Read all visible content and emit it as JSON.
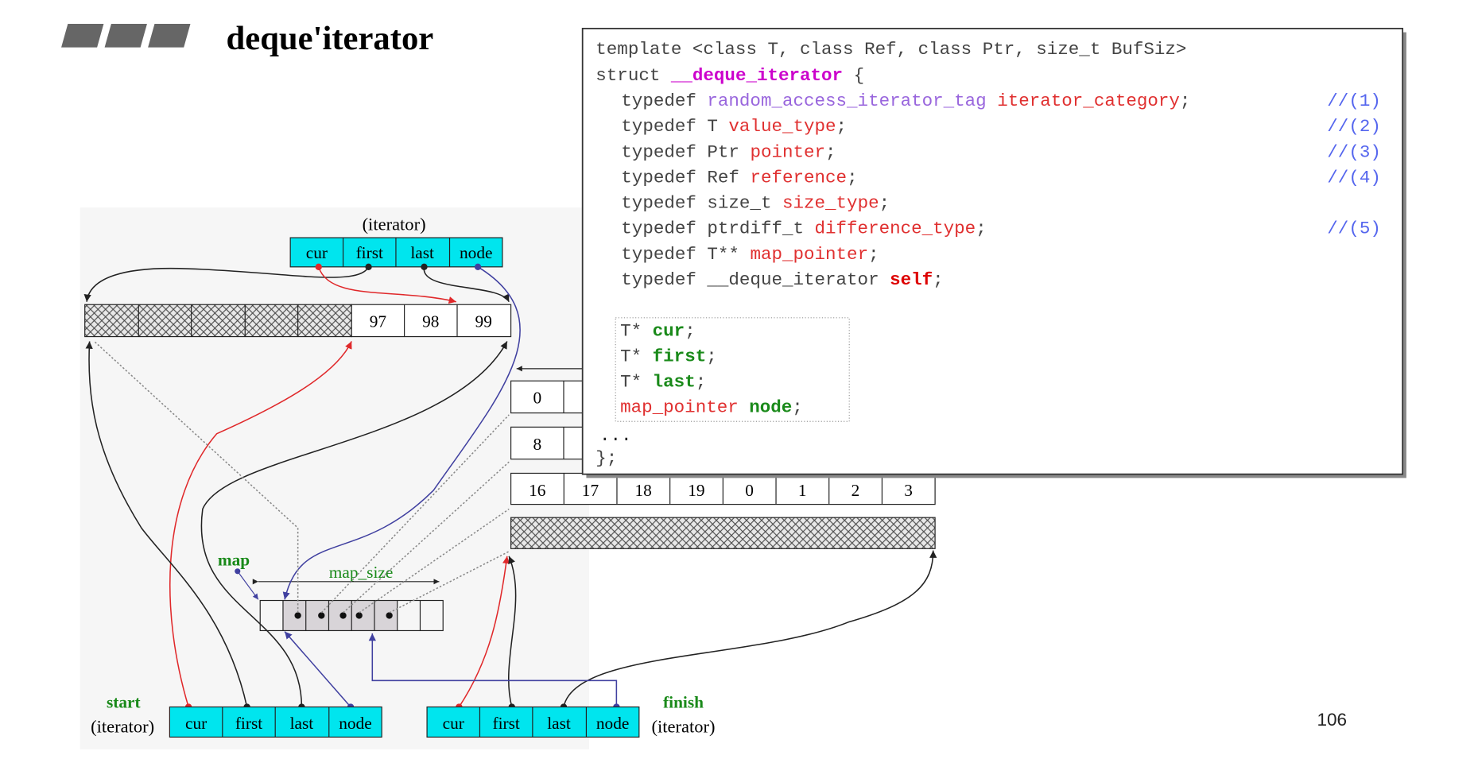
{
  "slide": {
    "title": "deque'iterator",
    "page_number": "106"
  },
  "code": {
    "line_template": "template <class T, class Ref, class Ptr, size_t BufSiz>",
    "struct_kw": "struct ",
    "struct_name": "__deque_iterator",
    "struct_open": " {",
    "typedefs": [
      {
        "kw": "typedef ",
        "type": "random_access_iterator_tag",
        "name": "iterator_category",
        "comment": "//(1)"
      },
      {
        "kw": "typedef ",
        "type": "T",
        "name": "value_type",
        "comment": "//(2)"
      },
      {
        "kw": "typedef ",
        "type": "Ptr",
        "name": "pointer",
        "comment": "//(3)"
      },
      {
        "kw": "typedef ",
        "type": "Ref",
        "name": "reference",
        "comment": "//(4)"
      },
      {
        "kw": "typedef ",
        "type": "size_t",
        "name": "size_type",
        "comment": ""
      },
      {
        "kw": "typedef ",
        "type": "ptrdiff_t",
        "name": "difference_type",
        "comment": "//(5)"
      },
      {
        "kw": "typedef ",
        "type": "T**",
        "name": "map_pointer",
        "comment": ""
      },
      {
        "kw": "typedef ",
        "type": "__deque_iterator",
        "name": "self",
        "comment": ""
      }
    ],
    "members": [
      {
        "type": "T* ",
        "name": "cur"
      },
      {
        "type": "T* ",
        "name": "first"
      },
      {
        "type": "T* ",
        "name": "last"
      },
      {
        "type": "map_pointer ",
        "name": "node"
      }
    ],
    "ellipsis": "...",
    "close": "};"
  },
  "diagram": {
    "iterator_label": "(iterator)",
    "iterator_fields": [
      "cur",
      "first",
      "last",
      "node"
    ],
    "top_buffer_values": [
      "97",
      "98",
      "99"
    ],
    "buffer_0": [
      "0"
    ],
    "buffer_8": [
      "8"
    ],
    "bottom_buffer_values": [
      "16",
      "17",
      "18",
      "19",
      "0",
      "1",
      "2",
      "3"
    ],
    "map_label": "map",
    "map_size_label": "map_size",
    "start_label": "start",
    "finish_label": "finish",
    "colors": {
      "cell": "#00e5ee",
      "green": "#1a8a1a",
      "red": "#e0282a",
      "blue": "#4040a0"
    }
  }
}
